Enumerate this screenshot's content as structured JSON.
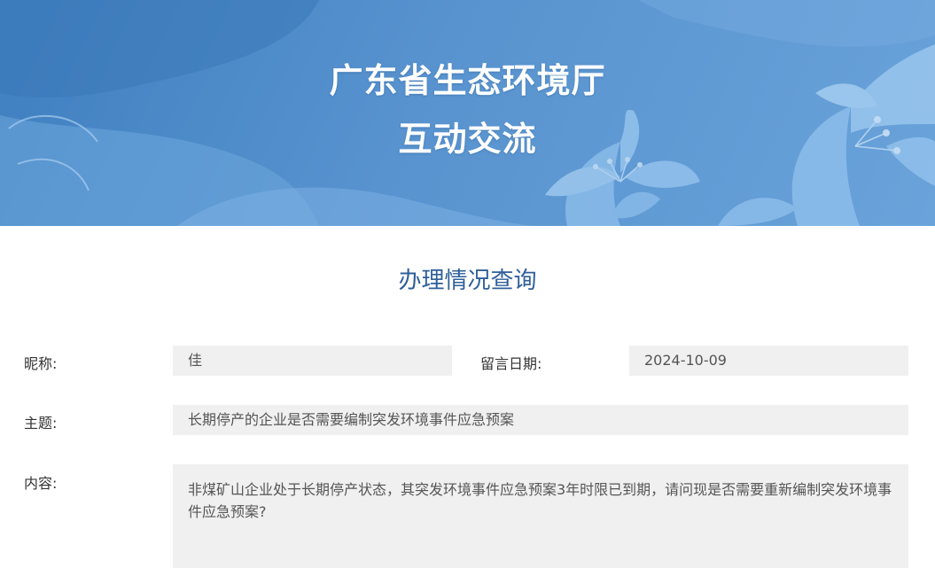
{
  "banner": {
    "title_line1": "广东省生态环境厅",
    "title_line2": "互动交流"
  },
  "section": {
    "title": "办理情况查询"
  },
  "form": {
    "nickname_label": "昵称:",
    "nickname_value": "佳",
    "date_label": "留言日期:",
    "date_value": "2024-10-09",
    "subject_label": "主题:",
    "subject_value": "长期停产的企业是否需要编制突发环境事件应急预案",
    "content_label": "内容:",
    "content_value": "非煤矿山企业处于长期停产状态，其突发环境事件应急预案3年时限已到期，请问现是否需要重新编制突发环境事件应急预案?"
  },
  "colors": {
    "banner_blue": "#4f8ccb",
    "section_title": "#2f5f9a",
    "field_bg": "#f0f0f0"
  }
}
